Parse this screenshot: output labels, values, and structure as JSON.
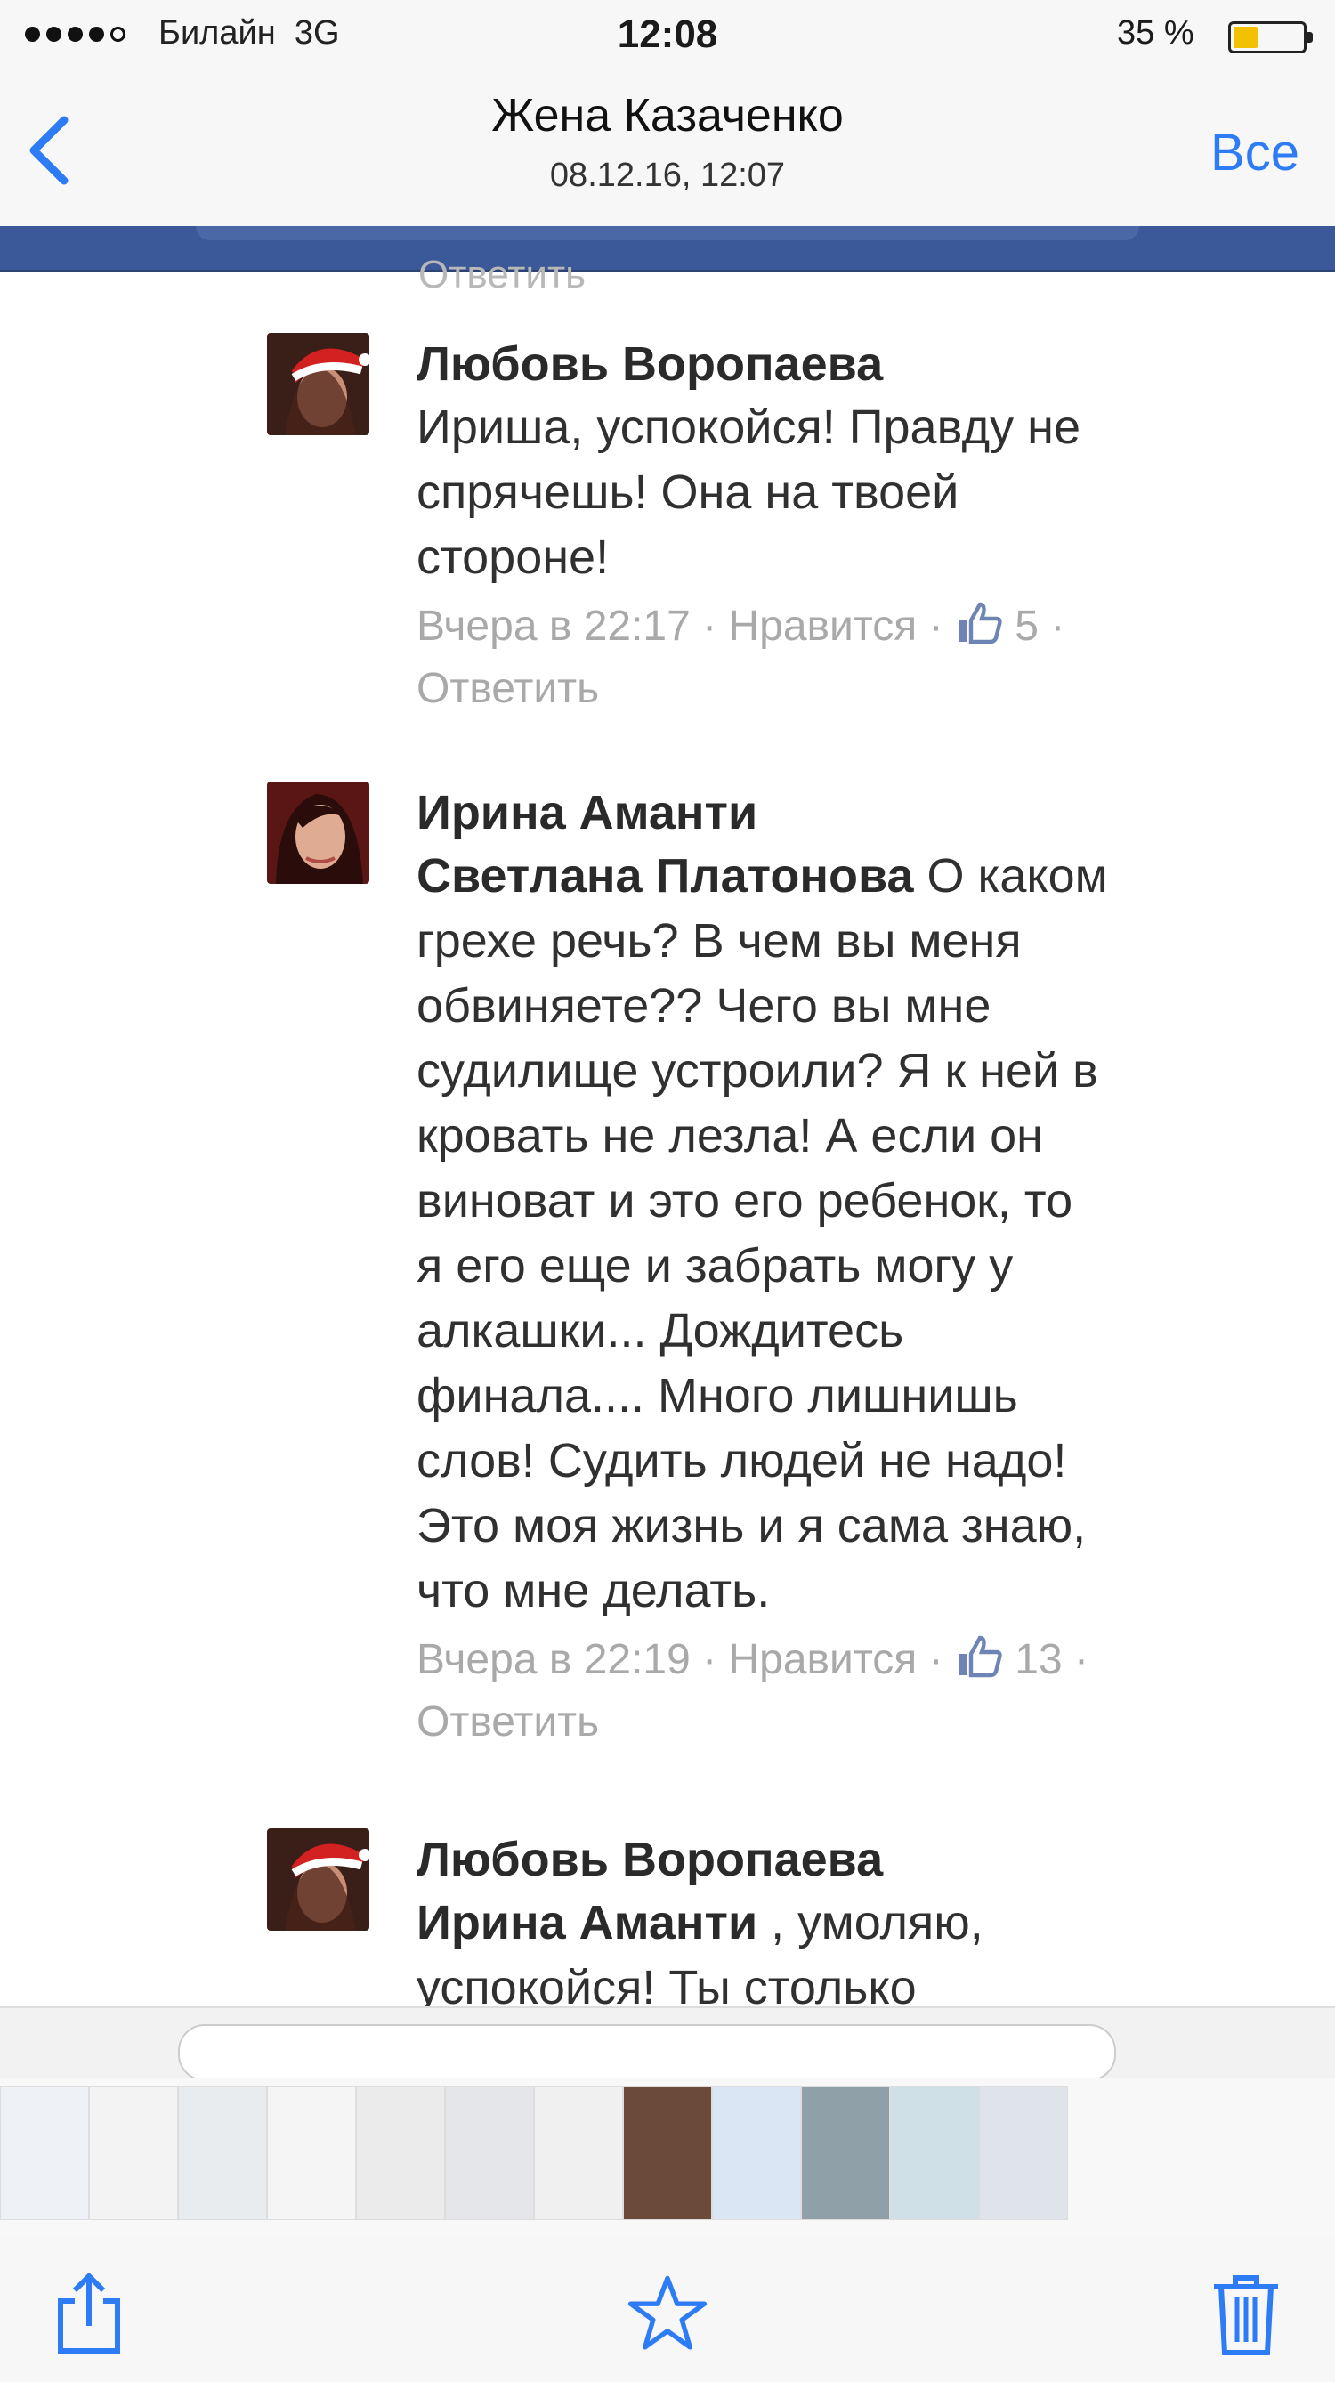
{
  "status_bar": {
    "carrier": "Билайн",
    "network": "3G",
    "time": "12:08",
    "battery_percent": "35 %",
    "battery_level": 0.35
  },
  "nav": {
    "back_icon": "chevron-left-icon",
    "title": "Жена Казаченко",
    "subtitle": "08.12.16, 12:07",
    "all_label": "Все"
  },
  "screenshot": {
    "top_cut_text": "Ответить",
    "comments": [
      {
        "author": "Любовь Воропаева",
        "mention": "",
        "text_lines": [
          "Ириша, успокойся! Правду не",
          "спрячешь! Она на твоей",
          "стороне!"
        ],
        "time": "Вчера в 22:17",
        "like_label": "Нравится",
        "likes": "5",
        "reply_label": "Ответить"
      },
      {
        "author": "Ирина Аманти",
        "mention": "Светлана Платонова",
        "first_line_rest": " О каком",
        "text_lines": [
          "грехе речь? В чем вы меня",
          "обвиняете?? Чего вы мне",
          "судилище устроили? Я к ней в",
          "кровать не лезла! А если он",
          "виноват и это его ребенок, то",
          "я его еще и забрать могу у",
          "алкашки... Дождитесь",
          "финала.... Много лишнишь",
          "слов! Судить людей не надо!",
          "Это моя жизнь и я сама знаю,",
          "что мне делать."
        ],
        "time": "Вчера в 22:19",
        "like_label": "Нравится",
        "likes": "13",
        "reply_label": "Ответить"
      },
      {
        "author": "Любовь Воропаева",
        "mention": "Ирина Аманти",
        "first_line_rest": " , умоляю,",
        "text_lines": [
          "успокойся! Ты столько"
        ]
      }
    ]
  },
  "toolbar": {
    "share_icon": "share-icon",
    "favorite_icon": "star-icon",
    "delete_icon": "trash-icon"
  },
  "colors": {
    "ios_blue": "#2e7bf6",
    "facebook_blue": "#3b5998",
    "meta_gray": "#a9a9a9"
  }
}
